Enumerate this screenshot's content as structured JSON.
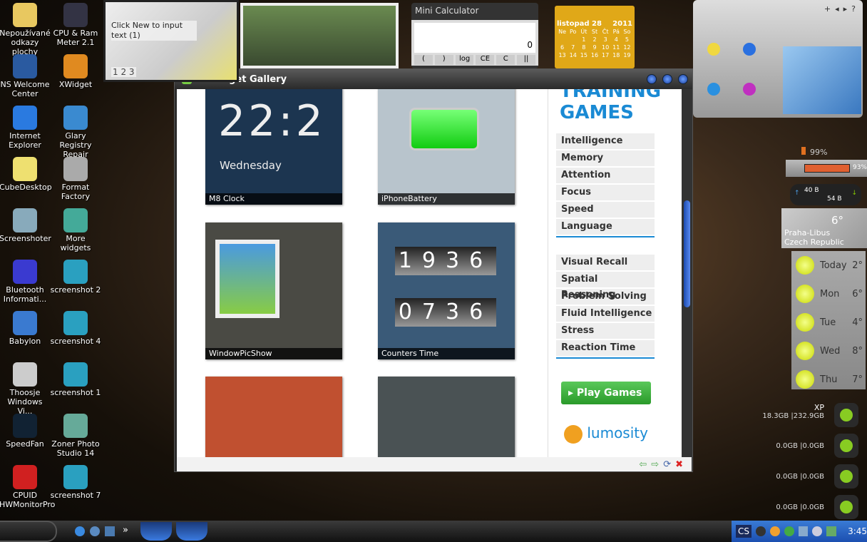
{
  "desktop_icons": [
    {
      "label": "Nepoužívané odkazy plochy",
      "icon": "folder-icon",
      "color": "#e8c860"
    },
    {
      "label": "CPU & Ram Meter 2.1",
      "icon": "meter-icon",
      "color": "#334"
    },
    {
      "label": "NS Welcome Center",
      "icon": "book-icon",
      "color": "#2a5aa0"
    },
    {
      "label": "XWidget",
      "icon": "xwidget-icon",
      "color": "#e08a20"
    },
    {
      "label": "Internet Explorer",
      "icon": "ie-icon",
      "color": "#2a7ae0"
    },
    {
      "label": "Glary Registry Repair",
      "icon": "registry-icon",
      "color": "#3a8ad0"
    },
    {
      "label": "CubeDesktop",
      "icon": "cube-icon",
      "color": "#eee070"
    },
    {
      "label": "Format Factory",
      "icon": "format-icon",
      "color": "#aaa"
    },
    {
      "label": "Screenshoter",
      "icon": "screenshot-icon",
      "color": "#8ab"
    },
    {
      "label": "More widgets",
      "icon": "widgets-icon",
      "color": "#4a9"
    },
    {
      "label": "Bluetooth Informati...",
      "icon": "bluetooth-icon",
      "color": "#3a3ad0"
    },
    {
      "label": "screenshot 2",
      "icon": "jpg-icon",
      "color": "#2aa0c0"
    },
    {
      "label": "Babylon",
      "icon": "babylon-icon",
      "color": "#3a7ad0"
    },
    {
      "label": "screenshot 4",
      "icon": "jpg-icon",
      "color": "#2aa0c0"
    },
    {
      "label": "Thoosje Windows Vi...",
      "icon": "gear-icon",
      "color": "#ccc"
    },
    {
      "label": "screenshot 1",
      "icon": "jpg-icon",
      "color": "#2aa0c0"
    },
    {
      "label": "SpeedFan",
      "icon": "speedfan-icon",
      "color": "#123"
    },
    {
      "label": "Zoner Photo Studio 14",
      "icon": "zoner-icon",
      "color": "#6a9"
    },
    {
      "label": "CPUID HWMonitorPro",
      "icon": "hwmonitor-icon",
      "color": "#d02020"
    },
    {
      "label": "screenshot 7",
      "icon": "jpg-icon",
      "color": "#2aa0c0"
    }
  ],
  "note_widget": {
    "text": "Click New to input text (1)",
    "pages": "1 2 3"
  },
  "calculator": {
    "title": "Mini Calculator",
    "display": "0",
    "buttons": [
      "(",
      ")",
      "log",
      "CE",
      "C",
      "||"
    ]
  },
  "calendar": {
    "month": "listopad 28",
    "year": "2011",
    "days": [
      "Ne",
      "Po",
      "Út",
      "St",
      "Čt",
      "Pá",
      "So"
    ],
    "rows": [
      [
        "",
        "",
        "1",
        "2",
        "3",
        "4",
        "5"
      ],
      [
        "6",
        "7",
        "8",
        "9",
        "10",
        "11",
        "12"
      ],
      [
        "13",
        "14",
        "15",
        "16",
        "17",
        "18",
        "19"
      ]
    ]
  },
  "window": {
    "title": "XWidget Gallery",
    "tiles": [
      {
        "caption": "M8 Clock",
        "bg": "#1c3550",
        "text": "22:2",
        "sub": "Wednesday"
      },
      {
        "caption": "iPhoneBattery",
        "bg": "#b8c4cc"
      },
      {
        "caption": "WindowPicShow",
        "bg": "#4a4a44"
      },
      {
        "caption": "Counters Time",
        "bg": "#3a5a78",
        "rows": [
          "1936",
          "0736"
        ]
      },
      {
        "caption": "",
        "bg": "#c05030"
      },
      {
        "caption": "",
        "bg": "#4a5254"
      }
    ],
    "ad": {
      "heading1": "TRAINING",
      "heading2": "GAMES",
      "group1": [
        "Intelligence",
        "Memory",
        "Attention",
        "Focus",
        "Speed",
        "Language"
      ],
      "group2": [
        "Visual Recall",
        "Spatial Reasoning",
        "Problem Solving",
        "Fluid Intelligence",
        "Stress",
        "Reaction Time"
      ],
      "button": "Play Games",
      "logo": "lumosity",
      "accent": "#1a8ad4"
    },
    "footer_icons": [
      "back-arrow-icon",
      "forward-arrow-icon",
      "refresh-icon",
      "close-icon"
    ]
  },
  "system": {
    "battery": "99%",
    "bar": "93%",
    "net_up": "40 B",
    "net_down": "54 B",
    "weather": {
      "temp": "6°",
      "location1": "Praha-Libus",
      "location2": "Czech Republic"
    },
    "forecast": [
      {
        "day": "Today",
        "temp": "2°"
      },
      {
        "day": "Mon",
        "temp": "6°"
      },
      {
        "day": "Tue",
        "temp": "4°"
      },
      {
        "day": "Wed",
        "temp": "8°"
      },
      {
        "day": "Thu",
        "temp": "7°"
      }
    ],
    "drives": [
      {
        "name": "XP",
        "usage": "18.3GB |232.9GB"
      },
      {
        "name": "",
        "usage": "0.0GB |0.0GB"
      },
      {
        "name": "",
        "usage": "0.0GB |0.0GB"
      },
      {
        "name": "",
        "usage": "0.0GB |0.0GB"
      }
    ]
  },
  "taskbar": {
    "lang": "CS",
    "clock": "3:45",
    "more": "»"
  }
}
